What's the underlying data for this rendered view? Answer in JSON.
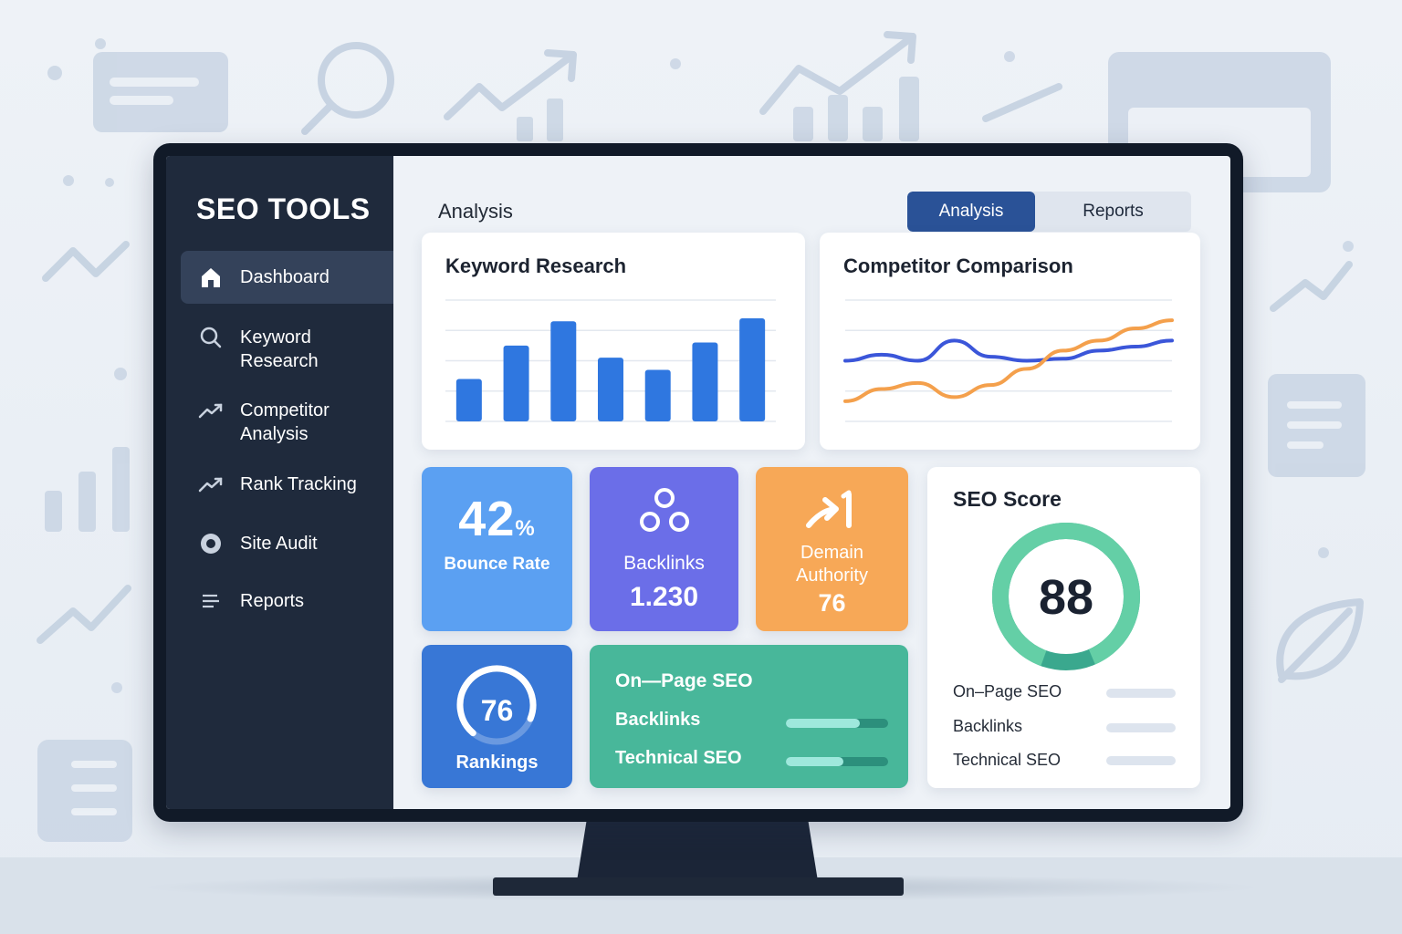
{
  "sidebar": {
    "brand": "SEO TOOLS",
    "items": [
      {
        "label": "Dashboard",
        "icon": "home-icon",
        "active": true
      },
      {
        "label": "Keyword\nResearch",
        "icon": "search-icon",
        "active": false
      },
      {
        "label": "Competitor\nAnalysis",
        "icon": "trend-icon",
        "active": false
      },
      {
        "label": "Rank Tracking",
        "icon": "trend-icon",
        "active": false
      },
      {
        "label": "Site Audit",
        "icon": "target-icon",
        "active": false
      },
      {
        "label": "Reports",
        "icon": "list-icon",
        "active": false
      }
    ]
  },
  "header": {
    "title": "Analysis",
    "tabs": [
      {
        "label": "Analysis",
        "active": true
      },
      {
        "label": "Reports",
        "active": false
      }
    ]
  },
  "keyword_research": {
    "title": "Keyword Research",
    "chart_data": {
      "type": "bar",
      "values": [
        1.4,
        2.5,
        3.3,
        2.1,
        1.7,
        2.6,
        3.4
      ],
      "ylim": [
        0,
        4
      ],
      "grid": true,
      "color": "#2f77e0"
    }
  },
  "competitor_comparison": {
    "title": "Competitor Comparison",
    "chart_data": {
      "type": "line",
      "series": [
        {
          "color": "#3b56d9",
          "values": [
            3.0,
            3.3,
            3.0,
            4.0,
            3.2,
            3.0,
            3.1,
            3.5,
            3.7,
            4.0
          ]
        },
        {
          "color": "#f4a04c",
          "values": [
            1.0,
            1.6,
            1.9,
            1.2,
            1.8,
            2.6,
            3.5,
            4.0,
            4.6,
            5.0
          ]
        }
      ],
      "ylim": [
        0,
        6
      ],
      "grid": true
    }
  },
  "tiles": {
    "bounce": {
      "value": "42",
      "unit": "%",
      "label": "Bounce Rate",
      "color": "#5ba0f2"
    },
    "backlinks": {
      "label": "Backlinks",
      "value": "1.230",
      "color": "#6b6ee8"
    },
    "domain": {
      "label": "Demain\nAuthority",
      "value": "76",
      "color": "#f7a857"
    },
    "rankings": {
      "value": "76",
      "label": "Rankings",
      "gauge": 0.7,
      "color": "#3877d6"
    },
    "onpage": {
      "title": "On—Page SEO",
      "color": "#48b79a",
      "rows": [
        {
          "label": "Backlinks",
          "value": 0.72
        },
        {
          "label": "Technical SEO",
          "value": 0.56
        }
      ]
    }
  },
  "seo_score": {
    "title": "SEO Score",
    "score": "88",
    "progress": 0.88,
    "rows": [
      {
        "label": "On–Page SEO"
      },
      {
        "label": "Backlinks"
      },
      {
        "label": "Technical SEO"
      }
    ]
  }
}
